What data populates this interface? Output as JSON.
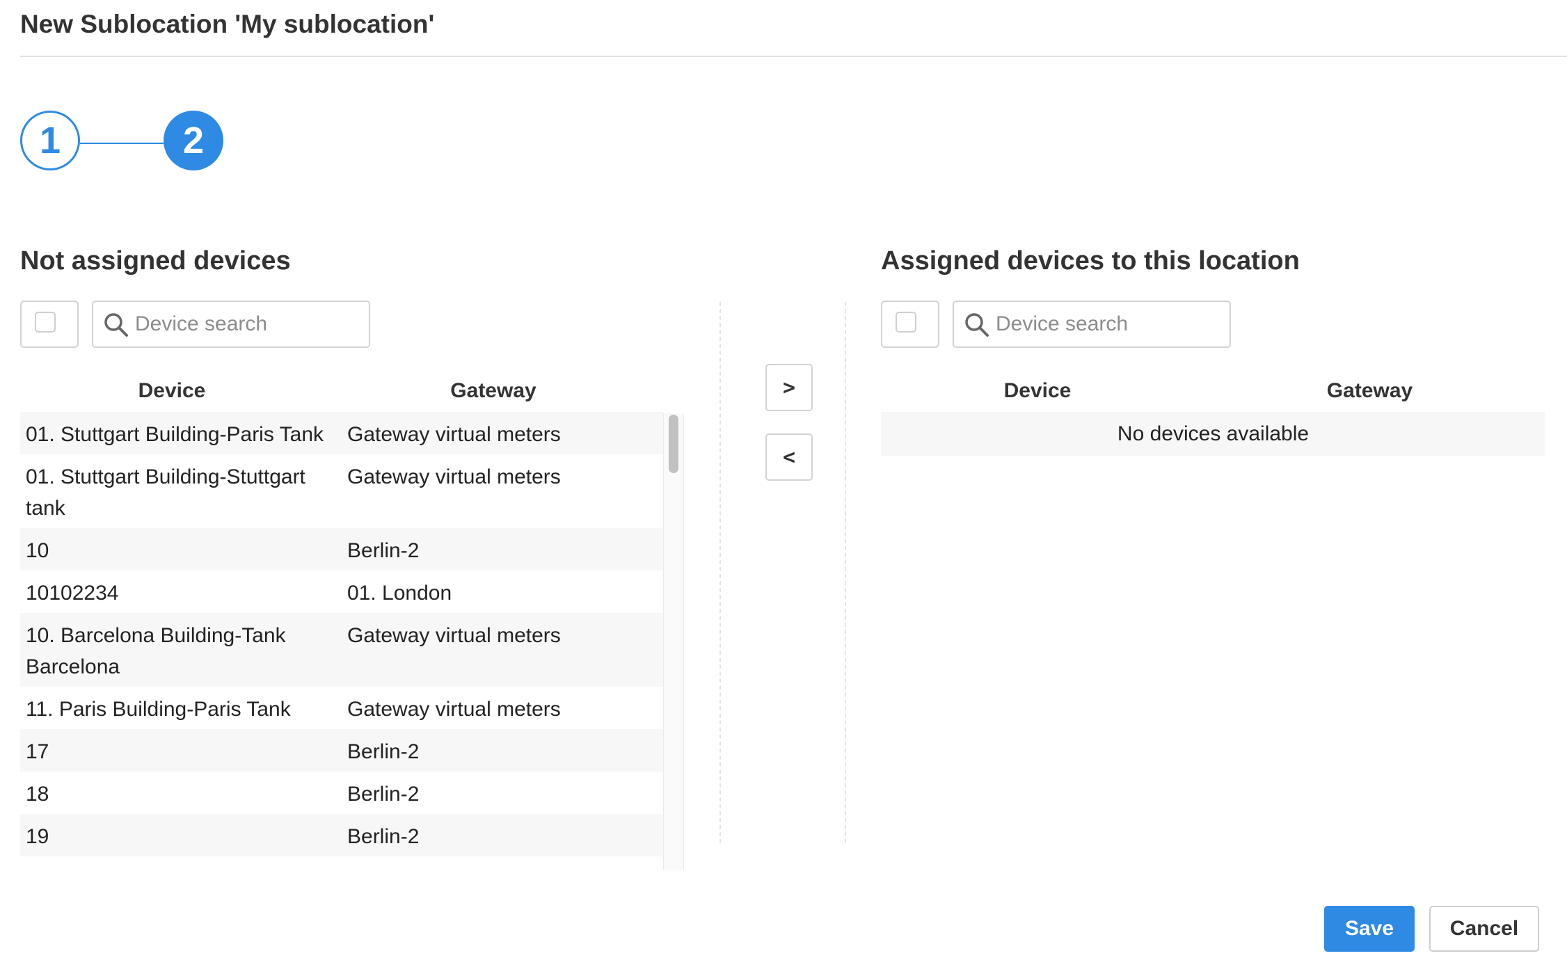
{
  "header": {
    "title": "New Sublocation 'My sublocation'"
  },
  "stepper": {
    "steps": [
      {
        "label": "1",
        "state": "completed"
      },
      {
        "label": "2",
        "state": "active"
      }
    ]
  },
  "left_panel": {
    "title": "Not assigned devices",
    "search": {
      "placeholder": "Device search",
      "value": ""
    },
    "columns": {
      "device": "Device",
      "gateway": "Gateway"
    },
    "rows": [
      {
        "device": "01. Stuttgart Building-Paris Tank",
        "gateway": "Gateway virtual meters"
      },
      {
        "device": "01. Stuttgart Building-Stuttgart tank",
        "gateway": "Gateway virtual meters"
      },
      {
        "device": "10",
        "gateway": "Berlin-2"
      },
      {
        "device": "10102234",
        "gateway": "01. London"
      },
      {
        "device": "10. Barcelona Building-Tank Barcelona",
        "gateway": "Gateway virtual meters"
      },
      {
        "device": "11. Paris Building-Paris Tank",
        "gateway": "Gateway virtual meters"
      },
      {
        "device": "17",
        "gateway": "Berlin-2"
      },
      {
        "device": "18",
        "gateway": "Berlin-2"
      },
      {
        "device": "19",
        "gateway": "Berlin-2"
      }
    ]
  },
  "transfer": {
    "add_label": ">",
    "remove_label": "<"
  },
  "right_panel": {
    "title": "Assigned devices to this location",
    "search": {
      "placeholder": "Device search",
      "value": ""
    },
    "columns": {
      "device": "Device",
      "gateway": "Gateway"
    },
    "empty_message": "No devices available"
  },
  "footer": {
    "save_label": "Save",
    "cancel_label": "Cancel"
  },
  "colors": {
    "accent": "#2f8ae3",
    "row_stripe": "#f7f7f7",
    "border": "#d2d2d2"
  }
}
